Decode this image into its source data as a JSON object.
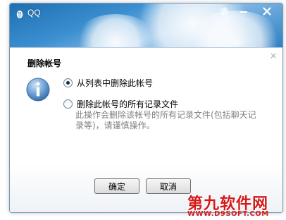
{
  "window": {
    "app_title": "QQ",
    "controls": [
      "gear-icon",
      "minimize-icon",
      "close-icon"
    ]
  },
  "dialog": {
    "heading": "删除帐号",
    "icon": "info-icon",
    "options": [
      {
        "label": "从列表中删除此帐号",
        "selected": true
      },
      {
        "label": "删除此帐号的所有记录文件",
        "selected": false
      }
    ],
    "description": "此操作会删除该帐号的所有记录文件(包括聊天记录等)，请谨慎操作。",
    "close_glyph": "×"
  },
  "buttons": {
    "ok": "确定",
    "cancel": "取消"
  },
  "watermark": {
    "name": "第九软件网",
    "url": "WWW.D9SOFT.COM"
  },
  "colors": {
    "title_blue": "#2f7fc2",
    "watermark_red": "#d41a1a"
  }
}
